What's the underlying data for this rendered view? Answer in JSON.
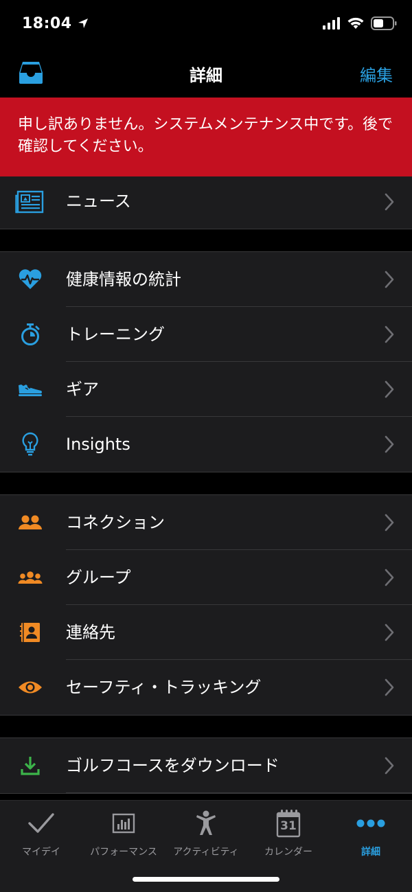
{
  "status": {
    "time": "18:04"
  },
  "nav": {
    "title": "詳細",
    "edit_label": "編集"
  },
  "banner": {
    "message": "申し訳ありません。システムメンテナンス中です。後で確認してください。"
  },
  "menu": {
    "news": {
      "label": "ニュース",
      "icon": "newspaper-icon",
      "color": "#2a9fe0"
    },
    "health_stats": {
      "label": "健康情報の統計",
      "icon": "heart-pulse-icon",
      "color": "#2a9fe0"
    },
    "training": {
      "label": "トレーニング",
      "icon": "stopwatch-icon",
      "color": "#2a9fe0"
    },
    "gear": {
      "label": "ギア",
      "icon": "shoe-icon",
      "color": "#2a9fe0"
    },
    "insights": {
      "label": "Insights",
      "icon": "lightbulb-icon",
      "color": "#2a9fe0"
    },
    "connections": {
      "label": "コネクション",
      "icon": "people-icon",
      "color": "#f08a24"
    },
    "groups": {
      "label": "グループ",
      "icon": "group-icon",
      "color": "#f08a24"
    },
    "contacts": {
      "label": "連絡先",
      "icon": "contacts-book-icon",
      "color": "#f08a24"
    },
    "safety_tracking": {
      "label": "セーフティ・トラッキング",
      "icon": "eye-icon",
      "color": "#f08a24"
    },
    "golf_download": {
      "label": "ゴルフコースをダウンロード",
      "icon": "download-icon",
      "color": "#3cb44a"
    }
  },
  "tabs": {
    "my_day": {
      "label": "マイデイ",
      "icon": "checkmark-icon"
    },
    "performance": {
      "label": "パフォーマンス",
      "icon": "bar-chart-icon"
    },
    "activities": {
      "label": "アクティビティ",
      "icon": "person-icon"
    },
    "calendar": {
      "label": "カレンダー",
      "icon": "calendar-icon",
      "day": "31"
    },
    "more": {
      "label": "詳細",
      "icon": "more-dots-icon"
    }
  },
  "colors": {
    "accent": "#2a9fe0",
    "banner": "#c41020",
    "row_bg": "#1c1c1e"
  }
}
